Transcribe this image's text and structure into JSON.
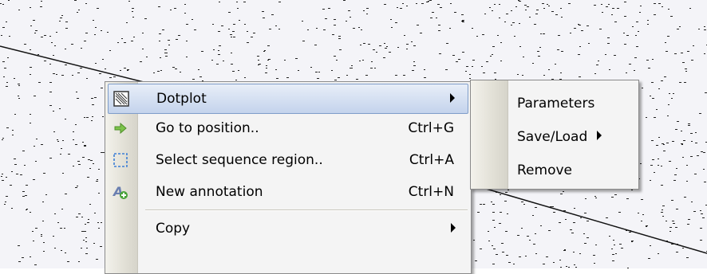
{
  "colors": {
    "highlight": "#c4d3ec",
    "background": "#f4f4f8",
    "menu_bg": "#f4f4f4"
  },
  "context_menu": {
    "items": [
      {
        "icon": "dotplot-icon",
        "label": "Dotplot",
        "shortcut": "",
        "submenu": true,
        "highlighted": true
      },
      {
        "icon": "green-arrow-icon",
        "label": "Go to position..",
        "shortcut": "Ctrl+G"
      },
      {
        "icon": "dashed-selection-icon",
        "label": "Select sequence region..",
        "shortcut": "Ctrl+A"
      },
      {
        "icon": "new-annotation-icon",
        "label": "New annotation",
        "shortcut": "Ctrl+N"
      },
      {
        "icon": "",
        "label": "Copy",
        "shortcut": "",
        "submenu": true
      }
    ]
  },
  "dotplot_submenu": {
    "items": [
      {
        "label": "Parameters"
      },
      {
        "label": "Save/Load",
        "submenu": true
      },
      {
        "label": "Remove"
      }
    ]
  }
}
